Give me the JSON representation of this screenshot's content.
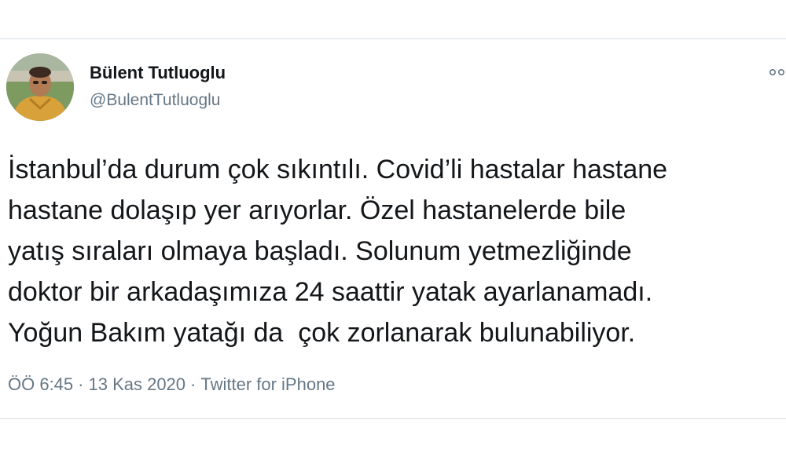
{
  "tweet": {
    "author": {
      "display_name": "Bülent Tutluoglu",
      "handle": "@BulentTutluoglu",
      "avatar_icon": "user-avatar-photo"
    },
    "more_icon": "more-options-icon",
    "text_lines": [
      "İstanbul’da durum çok sıkıntılı. Covid’li hastalar hastane",
      "hastane dolaşıp yer arıyorlar. Özel hastanelerde bile",
      "yatış sıraları olmaya başladı. Solunum yetmezliğinde",
      "doktor bir arkadaşımıza 24 saattir yatak ayarlanamadı.",
      "Yoğun Bakım yatağı da  çok zorlanarak bulunabiliyor."
    ],
    "meta": {
      "time": "ÖÖ 6:45",
      "date": "13 Kas 2020",
      "separator": "·",
      "source": "Twitter for iPhone"
    }
  },
  "colors": {
    "text": "#14171a",
    "secondary": "#657786",
    "divider": "#d6dde2"
  }
}
